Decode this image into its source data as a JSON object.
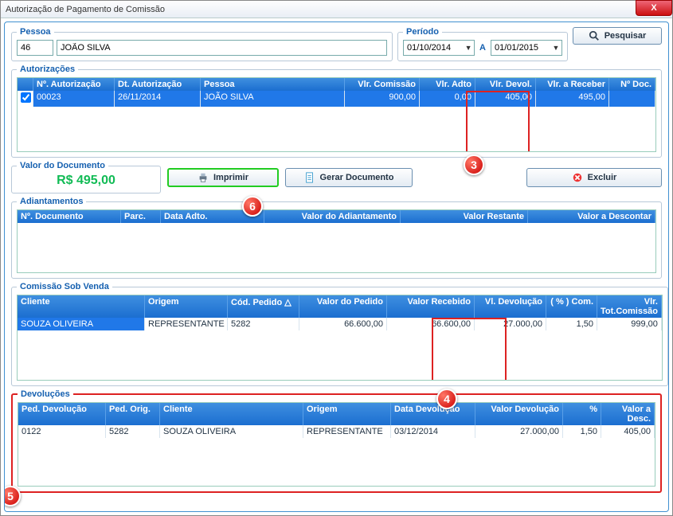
{
  "window": {
    "title": "Autorização de Pagamento de Comissão"
  },
  "icons": {
    "close": "X",
    "search": "search",
    "print": "print",
    "doc": "doc",
    "del": "del"
  },
  "pessoa": {
    "legend": "Pessoa",
    "codigo": "46",
    "nome": "JOÃO SILVA"
  },
  "periodo": {
    "legend": "Período",
    "inicio": "01/10/2014",
    "fim": "01/01/2015",
    "sep": "A"
  },
  "buttons": {
    "pesquisar": "Pesquisar",
    "imprimir": "Imprimir",
    "gerar": "Gerar Documento",
    "excluir": "Excluir"
  },
  "autorizacoes": {
    "legend": "Autorizações",
    "headers": {
      "chk": "",
      "num": "Nº. Autorização",
      "data": "Dt. Autorização",
      "pessoa": "Pessoa",
      "vlr_comissao": "Vlr. Comissão",
      "vlr_adto": "Vlr. Adto",
      "vlr_devol": "Vlr. Devol.",
      "vlr_receber": "Vlr. a Receber",
      "num_doc": "Nº Doc."
    },
    "row": {
      "checked": true,
      "num": "00023",
      "data": "26/11/2014",
      "pessoa": "JOÃO SILVA",
      "vlr_comissao": "900,00",
      "vlr_adto": "0,00",
      "vlr_devol": "405,00",
      "vlr_receber": "495,00",
      "num_doc": ""
    }
  },
  "valor_doc": {
    "legend": "Valor do Documento",
    "valor": "R$ 495,00"
  },
  "adiantamentos": {
    "legend": "Adiantamentos",
    "headers": {
      "num_doc": "Nº. Documento",
      "parc": "Parc.",
      "data": "Data Adto.",
      "valor_adto": "Valor do Adiantamento",
      "valor_rest": "Valor Restante",
      "valor_desc": "Valor a Descontar"
    }
  },
  "comissao_sob_venda": {
    "legend": "Comissão Sob Venda",
    "headers": {
      "cliente": "Cliente",
      "origem": "Origem",
      "cod_pedido": "Cód. Pedido △",
      "valor_pedido": "Valor do Pedido",
      "valor_recebido": "Valor Recebido",
      "vl_devolucao": "Vl. Devolução",
      "pct_com": "( % ) Com.",
      "vlr_tot_com": "Vlr. Tot.Comissão"
    },
    "row": {
      "cliente": "SOUZA OLIVEIRA",
      "origem": "REPRESENTANTE",
      "cod_pedido": "5282",
      "valor_pedido": "66.600,00",
      "valor_recebido": "66.600,00",
      "vl_devolucao": "27.000,00",
      "pct_com": "1,50",
      "vlr_tot_com": "999,00"
    }
  },
  "devolucoes": {
    "legend": "Devoluções",
    "headers": {
      "ped_dev": "Ped. Devolução",
      "ped_orig": "Ped. Orig.",
      "cliente": "Cliente",
      "origem": "Origem",
      "data_dev": "Data Devolução",
      "valor_dev": "Valor Devolução",
      "pct": "%",
      "valor_desc": "Valor a Desc."
    },
    "row": {
      "ped_dev": "0122",
      "ped_orig": "5282",
      "cliente": "SOUZA OLIVEIRA",
      "origem": "REPRESENTANTE",
      "data_dev": "03/12/2014",
      "valor_dev": "27.000,00",
      "pct": "1,50",
      "valor_desc": "405,00"
    }
  },
  "annotations": {
    "b3": "3",
    "b4": "4",
    "b5": "5",
    "b6": "6"
  }
}
